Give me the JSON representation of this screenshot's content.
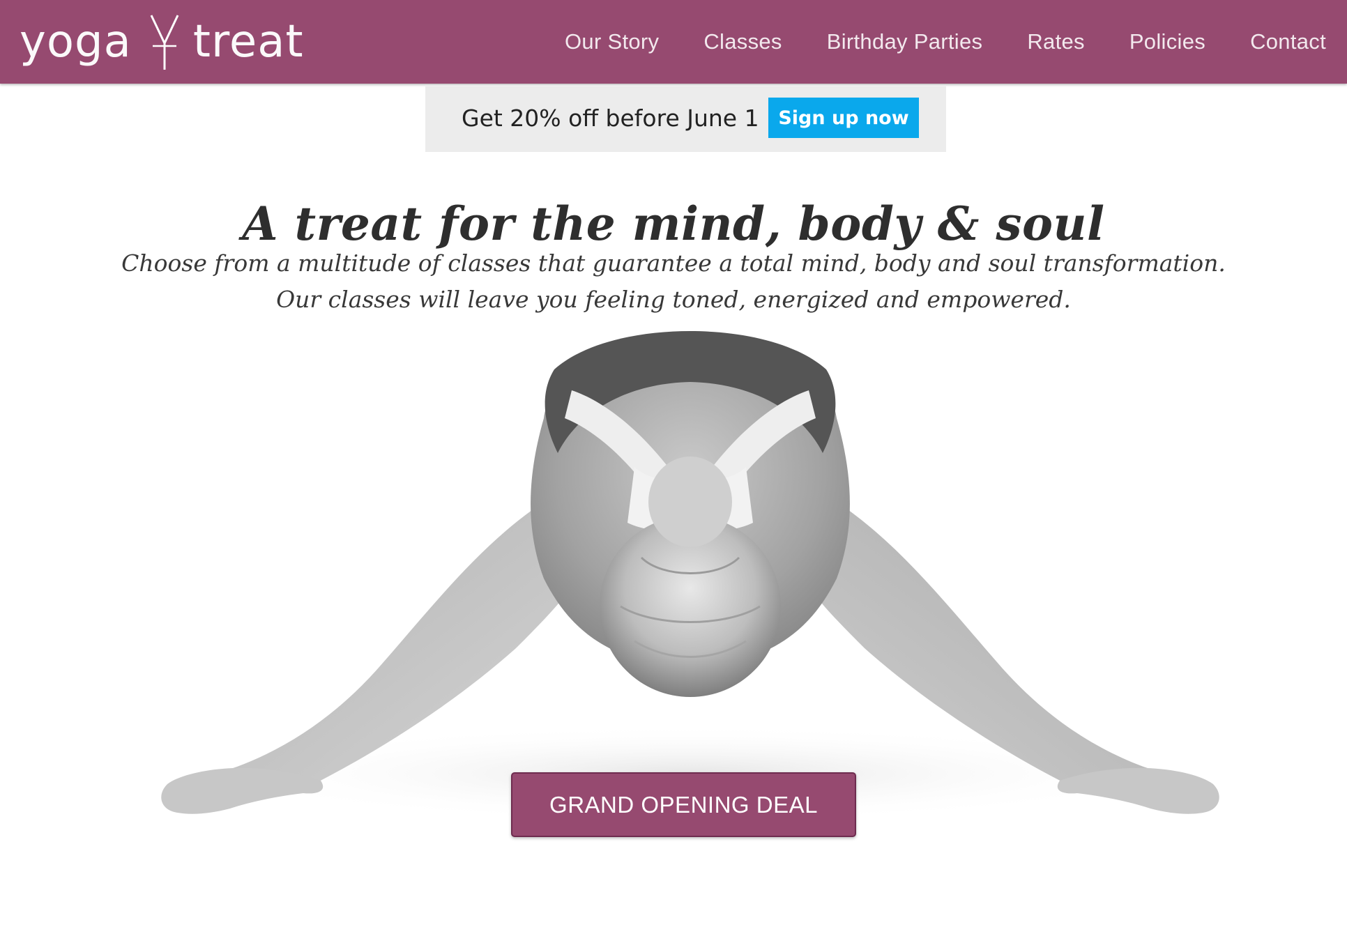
{
  "brand": {
    "logo_text_left": "yoga",
    "logo_text_right": "treat",
    "logo_icon": "y-tree-mark-icon",
    "primary_color": "#964a70",
    "accent_color": "#0aa8ec"
  },
  "nav": {
    "items": [
      {
        "label": "Our Story"
      },
      {
        "label": "Classes"
      },
      {
        "label": "Birthday Parties"
      },
      {
        "label": "Rates"
      },
      {
        "label": "Policies"
      },
      {
        "label": "Contact"
      }
    ]
  },
  "promo": {
    "text": "Get 20% off before June 1",
    "button_label": "Sign up now"
  },
  "hero": {
    "headline": "A treat for the mind, body & soul",
    "subtext_line1": "Choose from a multitude of classes that guarantee a total mind, body and soul transformation.",
    "subtext_line2": "Our classes will leave you feeling toned, energized and empowered.",
    "image": "woman-yoga-stretch-photo",
    "cta_label": "GRAND OPENING DEAL"
  }
}
